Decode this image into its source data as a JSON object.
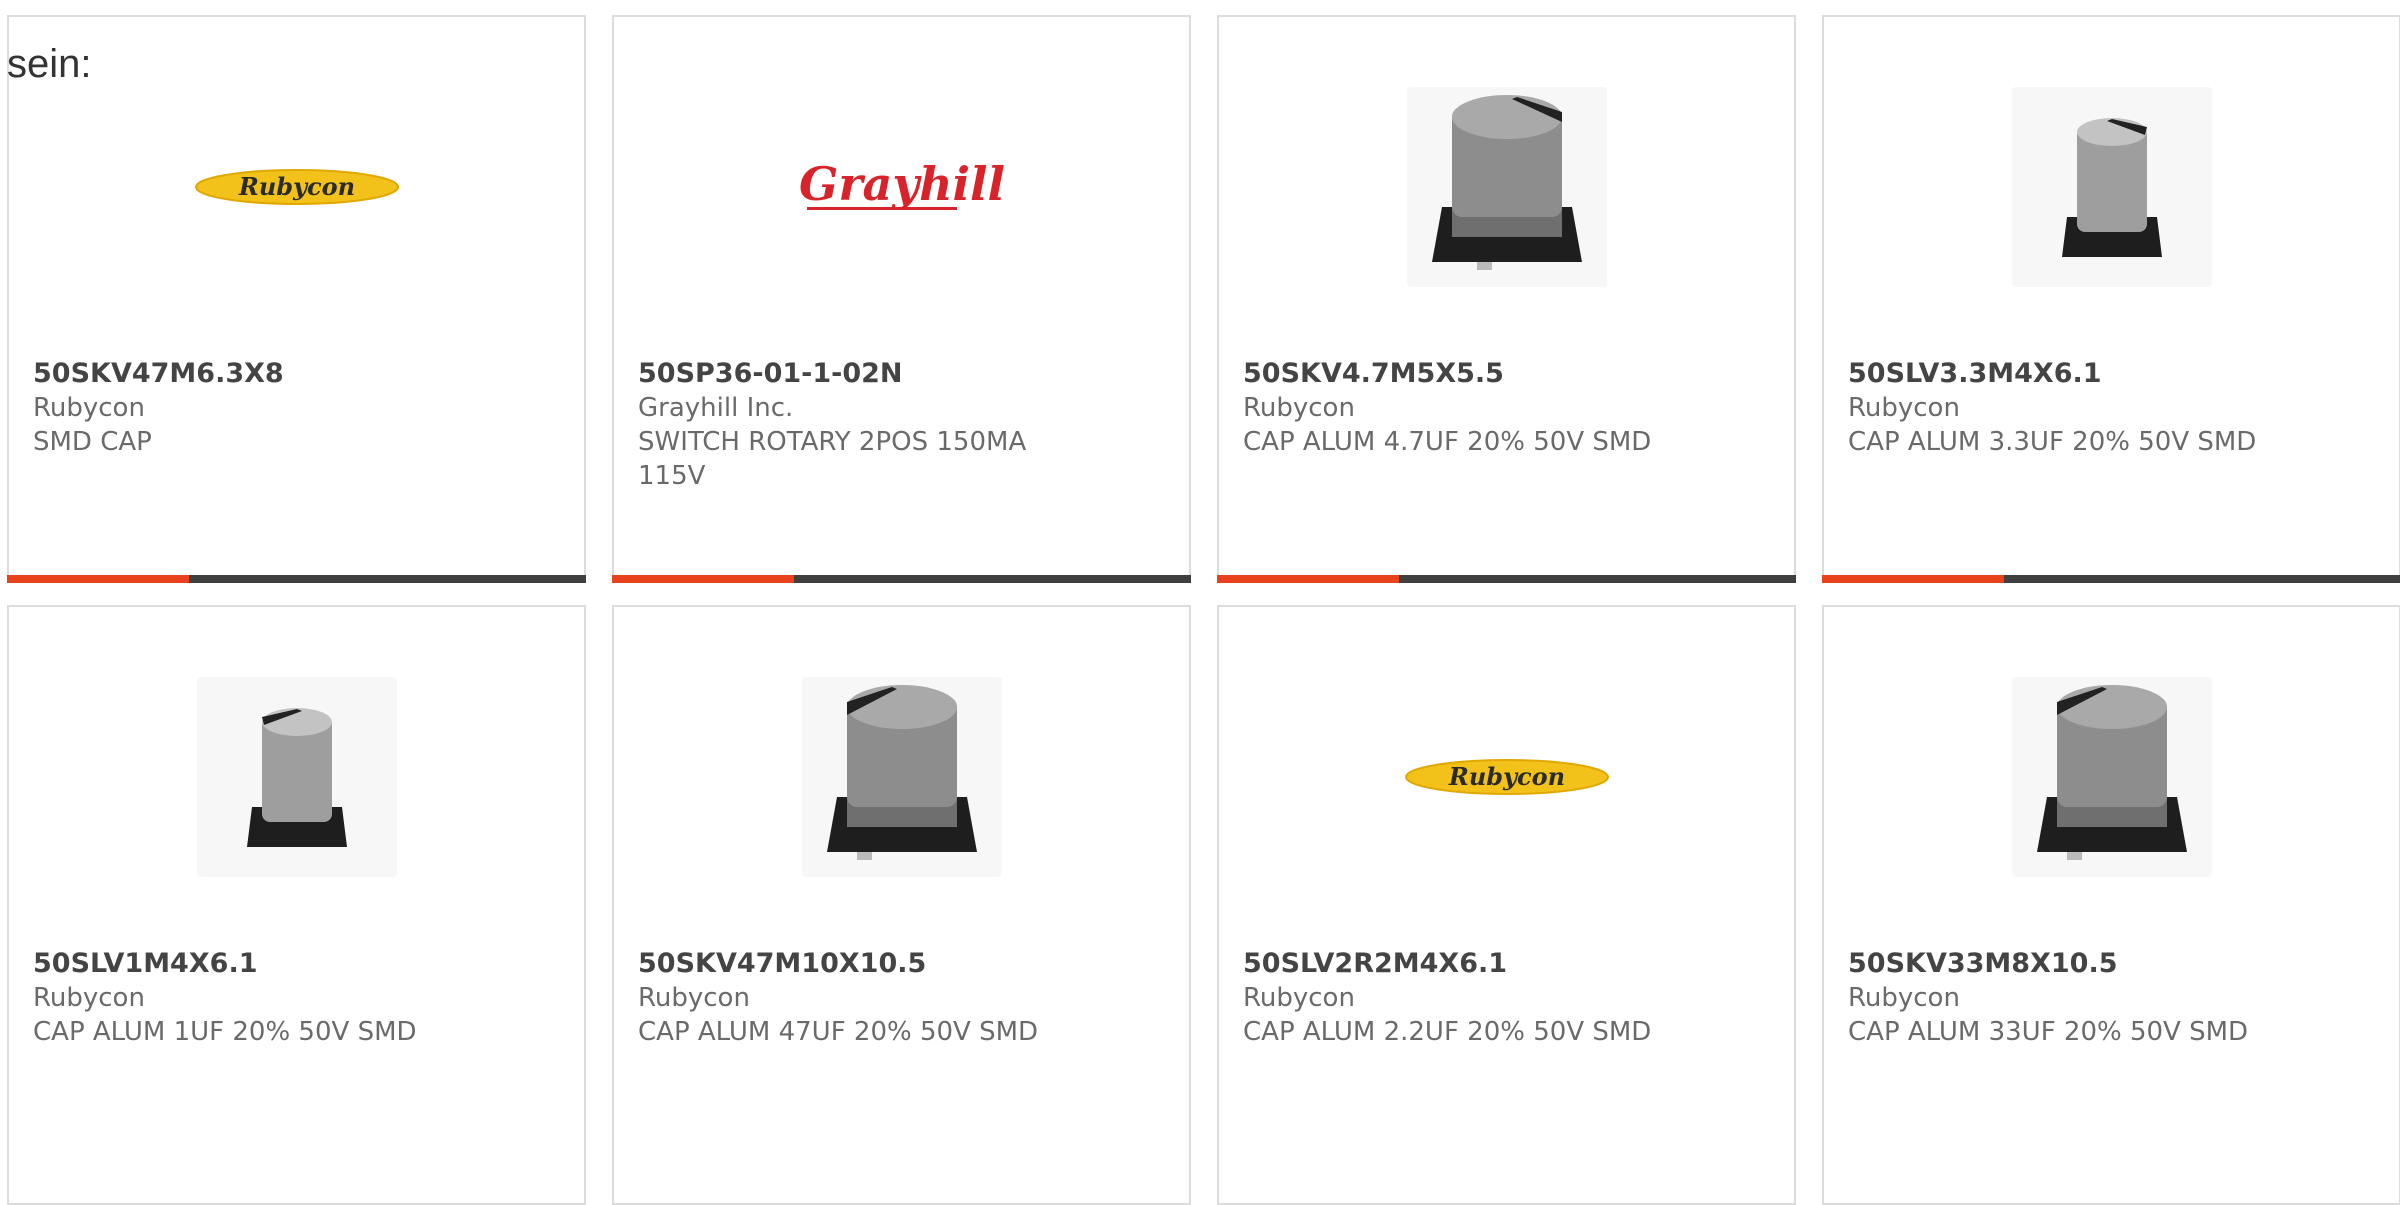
{
  "intro_text": "sein:",
  "products": [
    {
      "part_number": "50SKV47M6.3X8",
      "manufacturer": "Rubycon",
      "description": "SMD CAP",
      "image": "rubycon-logo"
    },
    {
      "part_number": "50SP36-01-1-02N",
      "manufacturer": "Grayhill Inc.",
      "description": "SWITCH ROTARY 2POS 150MA 115V",
      "image": "grayhill-logo"
    },
    {
      "part_number": "50SKV4.7M5X5.5",
      "manufacturer": "Rubycon",
      "description": "CAP ALUM 4.7UF 20% 50V SMD",
      "image": "capacitor-photo"
    },
    {
      "part_number": "50SLV3.3M4X6.1",
      "manufacturer": "Rubycon",
      "description": "CAP ALUM 3.3UF 20% 50V SMD",
      "image": "capacitor-photo-small"
    },
    {
      "part_number": "50SLV1M4X6.1",
      "manufacturer": "Rubycon",
      "description": "CAP ALUM 1UF 20% 50V SMD",
      "image": "capacitor-photo-small"
    },
    {
      "part_number": "50SKV47M10X10.5",
      "manufacturer": "Rubycon",
      "description": "CAP ALUM 47UF 20% 50V SMD",
      "image": "capacitor-photo"
    },
    {
      "part_number": "50SLV2R2M4X6.1",
      "manufacturer": "Rubycon",
      "description": "CAP ALUM 2.2UF 20% 50V SMD",
      "image": "rubycon-logo"
    },
    {
      "part_number": "50SKV33M8X10.5",
      "manufacturer": "Rubycon",
      "description": "CAP ALUM 33UF 20% 50V SMD",
      "image": "capacitor-photo"
    }
  ],
  "logos": {
    "rubycon": "Rubycon",
    "grayhill": "Grayhill"
  },
  "colors": {
    "accent": "#e8421d",
    "bar": "#3f3f3f",
    "rubycon_yellow": "#f2c21a",
    "grayhill_red": "#d8232a"
  }
}
